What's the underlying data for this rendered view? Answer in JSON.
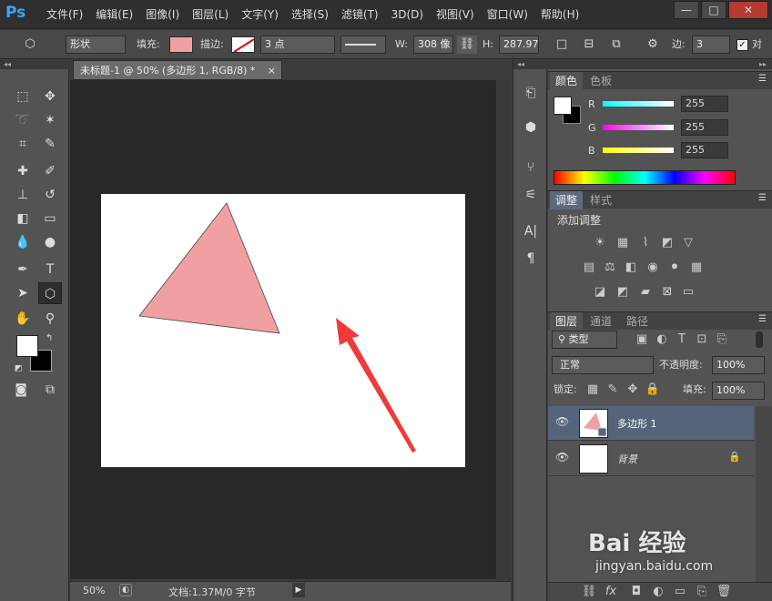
{
  "app": {
    "logo": "Ps"
  },
  "menu": [
    "文件(F)",
    "编辑(E)",
    "图像(I)",
    "图层(L)",
    "文字(Y)",
    "选择(S)",
    "滤镜(T)",
    "3D(D)",
    "视图(V)",
    "窗口(W)",
    "帮助(H)"
  ],
  "window": {
    "min": "—",
    "restore": "□",
    "close": "✕"
  },
  "options": {
    "mode": "形状",
    "fill_label": "填充:",
    "stroke_label": "描边:",
    "stroke_width": "3 点",
    "w_label": "W:",
    "w_value": "308 像",
    "h_label": "H:",
    "h_value": "287.97",
    "sides_label": "边:",
    "sides_value": "3",
    "align_label": "对",
    "fill_color": "#f0a0a3"
  },
  "document": {
    "tab_title": "未标题-1 @ 50% (多边形 1, RGB/8) *",
    "tab_close": "×"
  },
  "status": {
    "zoom": "50%",
    "doc_info": "文档:1.37M/0 字节"
  },
  "color_panel": {
    "tabs": [
      "颜色",
      "色板"
    ],
    "channels": [
      {
        "label": "R",
        "value": "255"
      },
      {
        "label": "G",
        "value": "255"
      },
      {
        "label": "B",
        "value": "255"
      }
    ]
  },
  "adjust_panel": {
    "tabs": [
      "调整",
      "样式"
    ],
    "title": "添加调整"
  },
  "layers_panel": {
    "tabs": [
      "图层",
      "通道",
      "路径"
    ],
    "filter": "类型",
    "blend_mode": "正常",
    "opacity_label": "不透明度:",
    "opacity": "100%",
    "lock_label": "锁定:",
    "fill_label": "填充:",
    "fill": "100%",
    "layers": [
      {
        "name": "多边形 1"
      },
      {
        "name": "背景"
      }
    ]
  },
  "watermark": {
    "brand": "Bai 经验",
    "url": "jingyan.baidu.com"
  }
}
